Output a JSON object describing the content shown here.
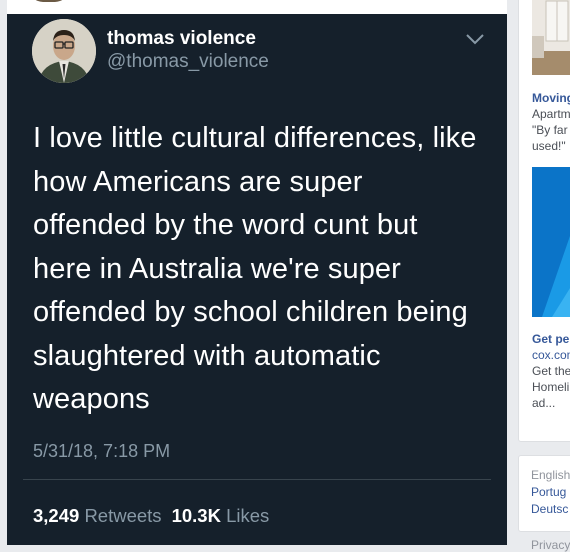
{
  "tweet": {
    "display_name": "thomas violence",
    "handle": "@thomas_violence",
    "text": "I love little cultural differences, like how Americans are super offended by the word cunt but here in Australia we're super offended by school children being slaughtered with automatic weapons",
    "timestamp": "5/31/18, 7:18 PM",
    "retweets_count": "3,249",
    "retweets_label": "Retweets",
    "likes_count": "10.3K",
    "likes_label": "Likes",
    "menu_icon": "chevron-down-icon"
  },
  "sidebar": {
    "ad1": {
      "title": "Moving",
      "line1": "Apartm",
      "line2": "\"By far",
      "line3": "used!\""
    },
    "ad2": {
      "title": "Get pe",
      "domain": "cox.com",
      "line1": "Get the",
      "line2": "Homeli",
      "line3": "ad..."
    },
    "languages": {
      "current": "English",
      "items": [
        "Portug",
        "Deutsc"
      ]
    },
    "footer_link": "Privacy"
  },
  "colors": {
    "tweet_bg": "#15202b",
    "secondary_text": "#8899a6",
    "link": "#365899"
  }
}
